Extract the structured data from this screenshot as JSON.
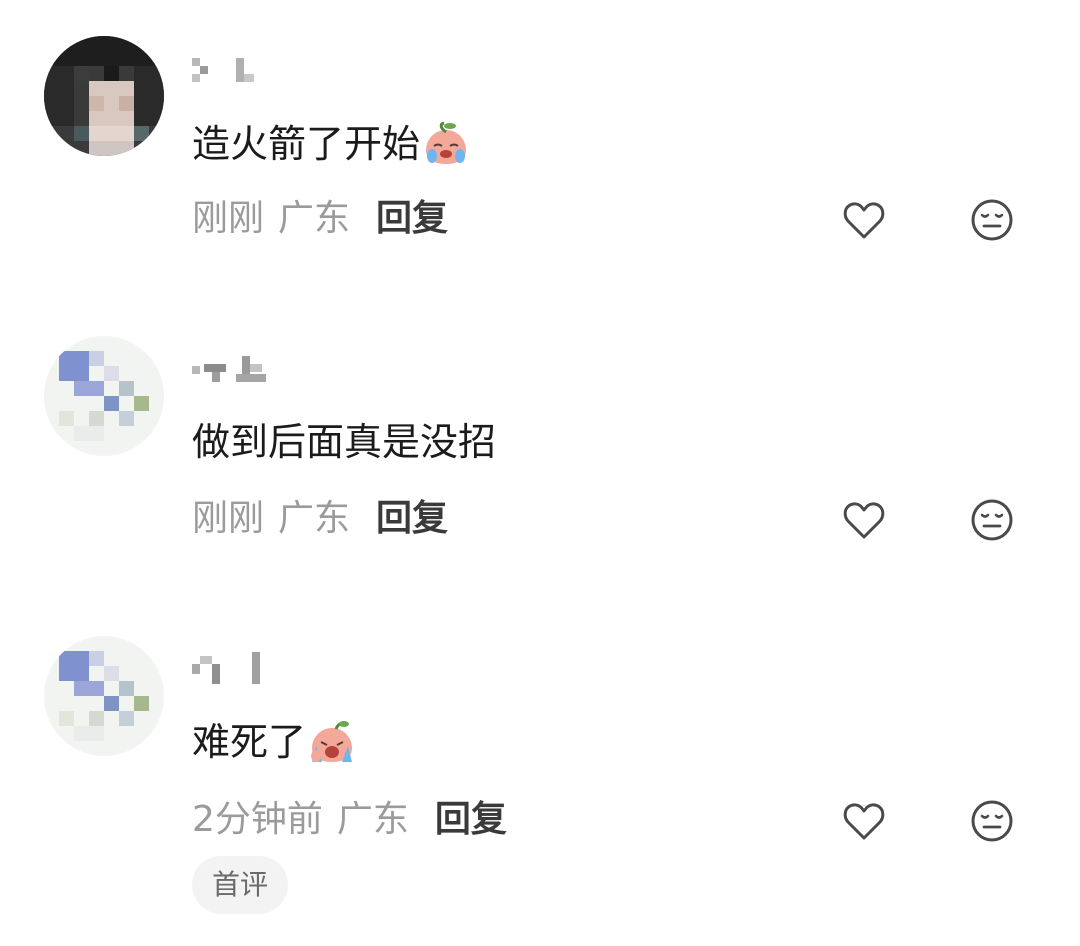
{
  "comments": [
    {
      "username": "",
      "text": "造火箭了开始",
      "emoji": "crying-peach-emoji",
      "time": "刚刚",
      "location": "广东",
      "reply_label": "回复"
    },
    {
      "username": "",
      "text": "做到后面真是没招",
      "time": "刚刚",
      "location": "广东",
      "reply_label": "回复"
    },
    {
      "username": "",
      "text": "难死了",
      "emoji": "sobbing-peach-emoji",
      "time": "2分钟前",
      "location": "广东",
      "reply_label": "回复",
      "badge": "首评"
    }
  ],
  "icons": {
    "like": "heart-outline-icon",
    "dislike": "meh-face-icon"
  },
  "colors": {
    "text": "#1b1b1b",
    "meta": "#9b9b9b",
    "reply": "#3a3a3a",
    "icon": "#4a4a4a",
    "badge_bg": "#f3f3f3"
  }
}
